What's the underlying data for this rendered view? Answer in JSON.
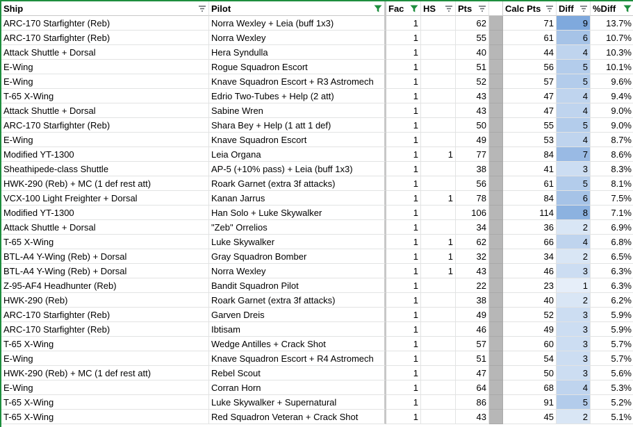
{
  "columns": {
    "ship": "Ship",
    "pilot": "Pilot",
    "fac": "Fac",
    "hs": "HS",
    "pts": "Pts",
    "calc_pts": "Calc Pts",
    "diff": "Diff",
    "pct_diff": "%Diff"
  },
  "header_filter_icons": {
    "ship": "filter-lines-icon",
    "pilot": "filter-funnel-icon",
    "fac": "filter-funnel-icon",
    "hs": "filter-lines-icon",
    "pts": "filter-lines-icon",
    "calc_pts": "filter-lines-icon",
    "diff": "filter-lines-icon",
    "pct_diff": "filter-funnel-icon"
  },
  "colors": {
    "grid_border": "#1e8e3e",
    "filter_active": "#1e8e3e",
    "gray_column": "#b7b7b7",
    "diff_scale_min": "#f3f7fc",
    "diff_scale_max": "#7fa9dd"
  },
  "rows": [
    {
      "ship": "ARC-170 Starfighter (Reb)",
      "pilot": "Norra Wexley + Leia (buff 1x3)",
      "fac": "1",
      "hs": "",
      "pts": "62",
      "calc_pts": "71",
      "diff": "9",
      "pct_diff": "13.7%"
    },
    {
      "ship": "ARC-170 Starfighter (Reb)",
      "pilot": "Norra Wexley",
      "fac": "1",
      "hs": "",
      "pts": "55",
      "calc_pts": "61",
      "diff": "6",
      "pct_diff": "10.7%"
    },
    {
      "ship": "Attack Shuttle + Dorsal",
      "pilot": "Hera Syndulla",
      "fac": "1",
      "hs": "",
      "pts": "40",
      "calc_pts": "44",
      "diff": "4",
      "pct_diff": "10.3%"
    },
    {
      "ship": "E-Wing",
      "pilot": "Rogue Squadron Escort",
      "fac": "1",
      "hs": "",
      "pts": "51",
      "calc_pts": "56",
      "diff": "5",
      "pct_diff": "10.1%"
    },
    {
      "ship": "E-Wing",
      "pilot": "Knave Squadron Escort + R3 Astromech",
      "fac": "1",
      "hs": "",
      "pts": "52",
      "calc_pts": "57",
      "diff": "5",
      "pct_diff": "9.6%"
    },
    {
      "ship": "T-65 X-Wing",
      "pilot": "Edrio Two-Tubes + Help (2 att)",
      "fac": "1",
      "hs": "",
      "pts": "43",
      "calc_pts": "47",
      "diff": "4",
      "pct_diff": "9.4%"
    },
    {
      "ship": "Attack Shuttle + Dorsal",
      "pilot": "Sabine Wren",
      "fac": "1",
      "hs": "",
      "pts": "43",
      "calc_pts": "47",
      "diff": "4",
      "pct_diff": "9.0%"
    },
    {
      "ship": "ARC-170 Starfighter (Reb)",
      "pilot": "Shara Bey + Help (1 att 1 def)",
      "fac": "1",
      "hs": "",
      "pts": "50",
      "calc_pts": "55",
      "diff": "5",
      "pct_diff": "9.0%"
    },
    {
      "ship": "E-Wing",
      "pilot": "Knave Squadron Escort",
      "fac": "1",
      "hs": "",
      "pts": "49",
      "calc_pts": "53",
      "diff": "4",
      "pct_diff": "8.7%"
    },
    {
      "ship": "Modified YT-1300",
      "pilot": "Leia Organa",
      "fac": "1",
      "hs": "1",
      "pts": "77",
      "calc_pts": "84",
      "diff": "7",
      "pct_diff": "8.6%"
    },
    {
      "ship": "Sheathipede-class Shuttle",
      "pilot": "AP-5 (+10% pass) + Leia (buff 1x3)",
      "fac": "1",
      "hs": "",
      "pts": "38",
      "calc_pts": "41",
      "diff": "3",
      "pct_diff": "8.3%"
    },
    {
      "ship": "HWK-290 (Reb) +  MC (1 def rest att)",
      "pilot": "Roark Garnet (extra 3f attacks)",
      "fac": "1",
      "hs": "",
      "pts": "56",
      "calc_pts": "61",
      "diff": "5",
      "pct_diff": "8.1%"
    },
    {
      "ship": "VCX-100 Light Freighter + Dorsal",
      "pilot": "Kanan Jarrus",
      "fac": "1",
      "hs": "1",
      "pts": "78",
      "calc_pts": "84",
      "diff": "6",
      "pct_diff": "7.5%"
    },
    {
      "ship": "Modified YT-1300",
      "pilot": "Han Solo + Luke Skywalker",
      "fac": "1",
      "hs": "",
      "pts": "106",
      "calc_pts": "114",
      "diff": "8",
      "pct_diff": "7.1%"
    },
    {
      "ship": "Attack Shuttle + Dorsal",
      "pilot": "\"Zeb\" Orrelios",
      "fac": "1",
      "hs": "",
      "pts": "34",
      "calc_pts": "36",
      "diff": "2",
      "pct_diff": "6.9%"
    },
    {
      "ship": "T-65 X-Wing",
      "pilot": "Luke Skywalker",
      "fac": "1",
      "hs": "1",
      "pts": "62",
      "calc_pts": "66",
      "diff": "4",
      "pct_diff": "6.8%"
    },
    {
      "ship": "BTL-A4 Y-Wing (Reb) + Dorsal",
      "pilot": "Gray Squadron Bomber",
      "fac": "1",
      "hs": "1",
      "pts": "32",
      "calc_pts": "34",
      "diff": "2",
      "pct_diff": "6.5%"
    },
    {
      "ship": "BTL-A4 Y-Wing (Reb) + Dorsal",
      "pilot": "Norra Wexley",
      "fac": "1",
      "hs": "1",
      "pts": "43",
      "calc_pts": "46",
      "diff": "3",
      "pct_diff": "6.3%"
    },
    {
      "ship": "Z-95-AF4 Headhunter (Reb)",
      "pilot": "Bandit Squadron Pilot",
      "fac": "1",
      "hs": "",
      "pts": "22",
      "calc_pts": "23",
      "diff": "1",
      "pct_diff": "6.3%"
    },
    {
      "ship": "HWK-290 (Reb)",
      "pilot": "Roark Garnet (extra 3f attacks)",
      "fac": "1",
      "hs": "",
      "pts": "38",
      "calc_pts": "40",
      "diff": "2",
      "pct_diff": "6.2%"
    },
    {
      "ship": "ARC-170 Starfighter (Reb)",
      "pilot": "Garven Dreis",
      "fac": "1",
      "hs": "",
      "pts": "49",
      "calc_pts": "52",
      "diff": "3",
      "pct_diff": "5.9%"
    },
    {
      "ship": "ARC-170 Starfighter (Reb)",
      "pilot": "Ibtisam",
      "fac": "1",
      "hs": "",
      "pts": "46",
      "calc_pts": "49",
      "diff": "3",
      "pct_diff": "5.9%"
    },
    {
      "ship": "T-65 X-Wing",
      "pilot": "Wedge Antilles + Crack Shot",
      "fac": "1",
      "hs": "",
      "pts": "57",
      "calc_pts": "60",
      "diff": "3",
      "pct_diff": "5.7%"
    },
    {
      "ship": "E-Wing",
      "pilot": "Knave Squadron Escort + R4 Astromech",
      "fac": "1",
      "hs": "",
      "pts": "51",
      "calc_pts": "54",
      "diff": "3",
      "pct_diff": "5.7%"
    },
    {
      "ship": "HWK-290 (Reb) +  MC (1 def rest att)",
      "pilot": "Rebel Scout",
      "fac": "1",
      "hs": "",
      "pts": "47",
      "calc_pts": "50",
      "diff": "3",
      "pct_diff": "5.6%"
    },
    {
      "ship": "E-Wing",
      "pilot": "Corran Horn",
      "fac": "1",
      "hs": "",
      "pts": "64",
      "calc_pts": "68",
      "diff": "4",
      "pct_diff": "5.3%"
    },
    {
      "ship": "T-65 X-Wing",
      "pilot": "Luke Skywalker + Supernatural",
      "fac": "1",
      "hs": "",
      "pts": "86",
      "calc_pts": "91",
      "diff": "5",
      "pct_diff": "5.2%"
    },
    {
      "ship": "T-65 X-Wing",
      "pilot": "Red Squadron Veteran + Crack Shot",
      "fac": "1",
      "hs": "",
      "pts": "43",
      "calc_pts": "45",
      "diff": "2",
      "pct_diff": "5.1%"
    }
  ]
}
